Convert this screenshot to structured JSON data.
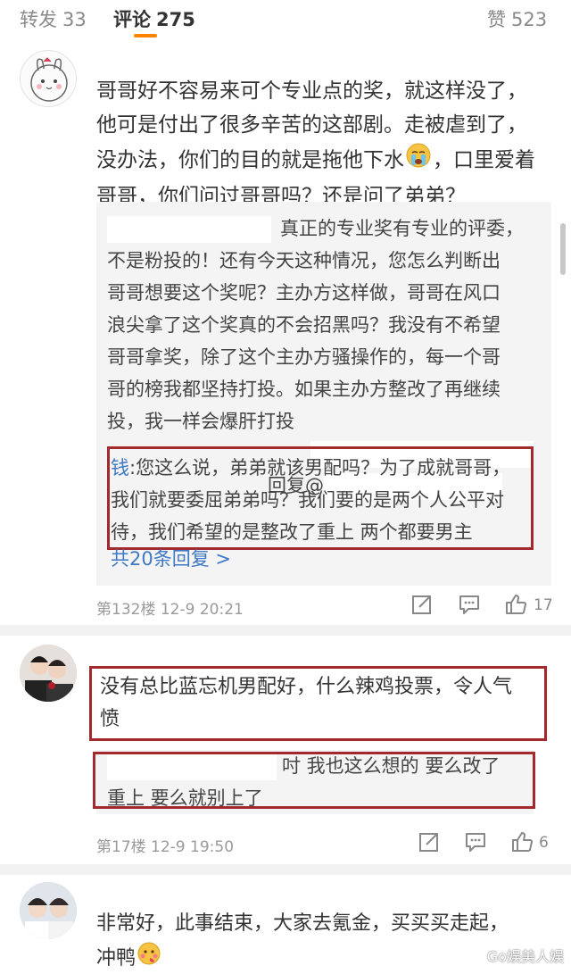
{
  "tabs": {
    "repost_label": "转发",
    "repost_count": "33",
    "comments_label": "评论",
    "comments_count": "275",
    "likes_label": "赞",
    "likes_count": "523"
  },
  "comments": [
    {
      "avatar_icon": "sketch-bunny-avatar",
      "lines": [
        "哥哥好不容易来可个专业点的奖，就这样没了，",
        "他可是付出了很多辛苦的这部剧。走被虐到了，",
        "没办法，你们的目的就是拖他下水",
        "，口里爱着",
        "哥哥，你们问过哥哥吗？还是问了弟弟？"
      ],
      "emoji_icon": "crying-face-icon",
      "reply": {
        "lines": [
          "真正的专业奖有专业的评委，",
          "不是粉投的！还有今天这种情况，您怎么判断出",
          "哥哥想要这个奖呢？主办方这样做，哥哥在风口",
          "浪尖拿了这个奖真的不会招黑吗？我没有不希望",
          "哥哥拿奖，除了这个主办方骚操作的，每一个哥",
          "哥的榜我都坚持打投。如果主办方整改了再继续",
          "投，我一样会爆肝打投"
        ],
        "reply_prefix": "回复@",
        "highlight_user": "钱",
        "highlight_lines": [
          ":您这么说，弟弟就该男配吗？为了成就哥哥，",
          "我们就要委屈弟弟吗？我们要的是两个人公平对",
          "待，我们希望的是整改了重上   两个都要男主"
        ],
        "more_replies": "共20条回复 >"
      },
      "meta": "第132楼 12-9 20:21",
      "likes": "17"
    },
    {
      "avatar_icon": "couple-photo-avatar",
      "lines": [
        "没有总比蓝忘机男配好，什么辣鸡投票，令人气",
        "愤"
      ],
      "reply_lines": [
        "吋   我也这么想的   要么改了",
        "重上   要么就别上了"
      ],
      "meta": "第17楼 12-9 19:50",
      "likes": "6"
    },
    {
      "avatar_icon": "two-boys-photo-avatar",
      "lines": [
        "非常好，此事结束，大家去氪金，买买买走起，",
        "冲鸭"
      ],
      "emoji_icon": "blushing-face-icon"
    }
  ],
  "watermark": "Go娱美人娱",
  "colors": {
    "accent": "#ff8200",
    "link": "#3f78c4",
    "frame": "#a22a2f"
  }
}
